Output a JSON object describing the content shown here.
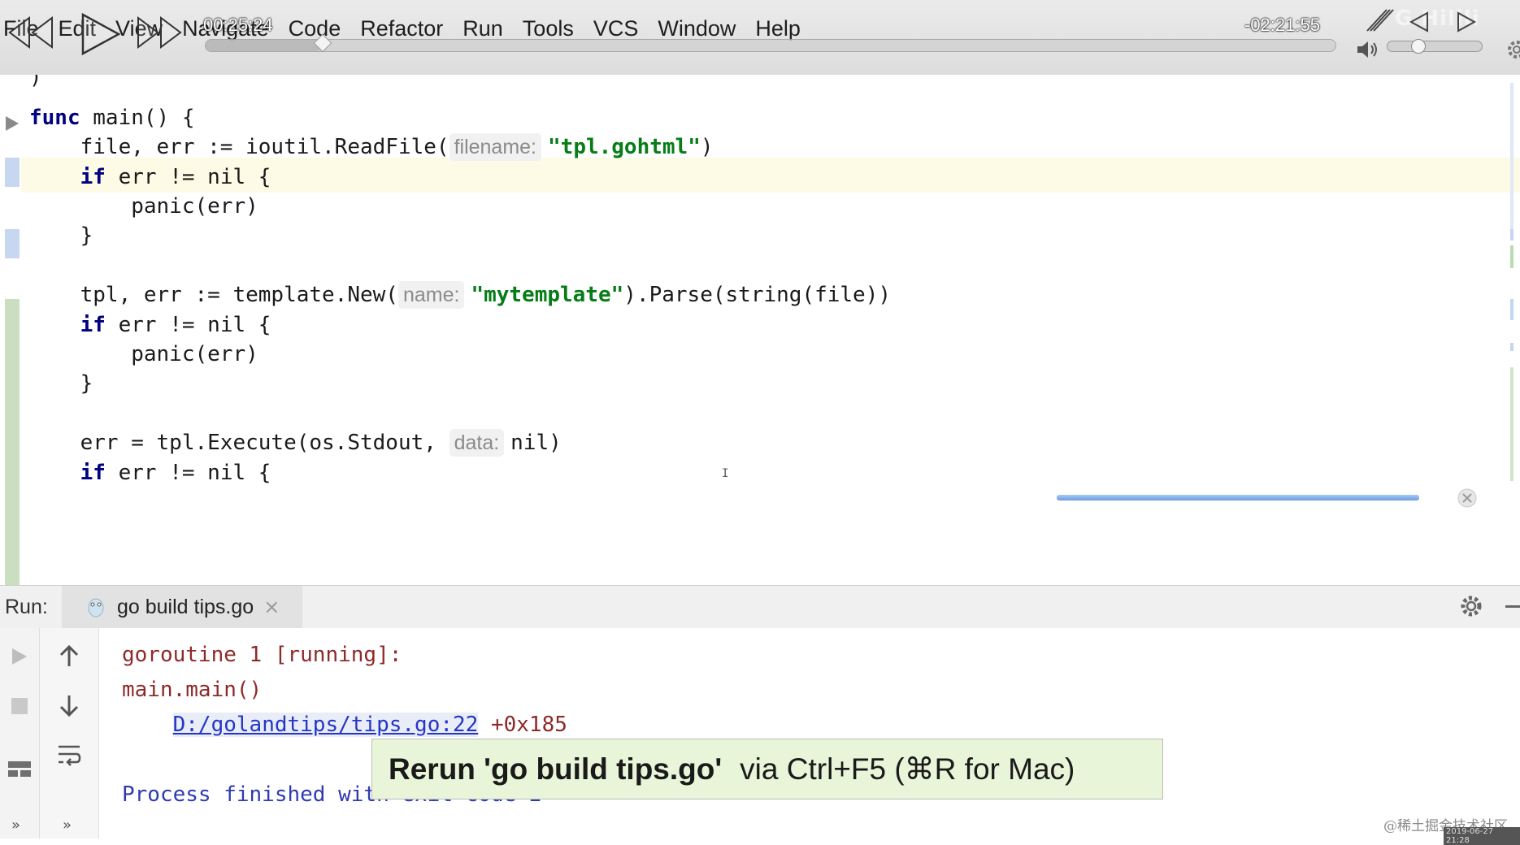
{
  "menu": {
    "items": [
      "File",
      "Edit",
      "View",
      "Navigate",
      "Code",
      "Refactor",
      "Run",
      "Tools",
      "VCS",
      "Window",
      "Help"
    ]
  },
  "player": {
    "time_elapsed": "00:25:24",
    "time_remaining": "-02:21:55",
    "watermark": "G  Hilili",
    "seek_position": 0.103,
    "volume_level": 0.25
  },
  "editor": {
    "lines": {
      "paren": ")",
      "func_kw": "func",
      "func_sig": " main() {",
      "l1_pre": "    file, err := ioutil.ReadFile(",
      "l1_hint": "filename:",
      "l1_str": "\"tpl.gohtml\"",
      "l1_post": ")",
      "if_kw": "if",
      "if_cond": " err != nil {",
      "panic": "        panic(err)",
      "close_brace": "    }",
      "l2_pre": "    tpl, err := template.New(",
      "l2_hint": "name:",
      "l2_str": "\"mytemplate\"",
      "l2_post": ").Parse(string(file))",
      "l3_pre": "    err = tpl.Execute(os.Stdout, ",
      "l3_hint": "data:",
      "l3_post": "nil)",
      "indent": "    "
    }
  },
  "run_panel": {
    "label": "Run:",
    "tab_label": "go build tips.go",
    "output": {
      "line1": "goroutine 1 [running]:",
      "line2": "main.main()",
      "link_indent": "    ",
      "link": "D:/golandtips/tips.go:22",
      "link_suffix": " +0x185",
      "process": "Process finished with exit code 2"
    }
  },
  "tooltip": {
    "bold": "Rerun 'go build tips.go'",
    "rest": "via Ctrl+F5 (⌘R for Mac)"
  },
  "watermark": {
    "text": "@稀土掘金技术社区",
    "timestamp": "2019-06-27 21:28"
  }
}
